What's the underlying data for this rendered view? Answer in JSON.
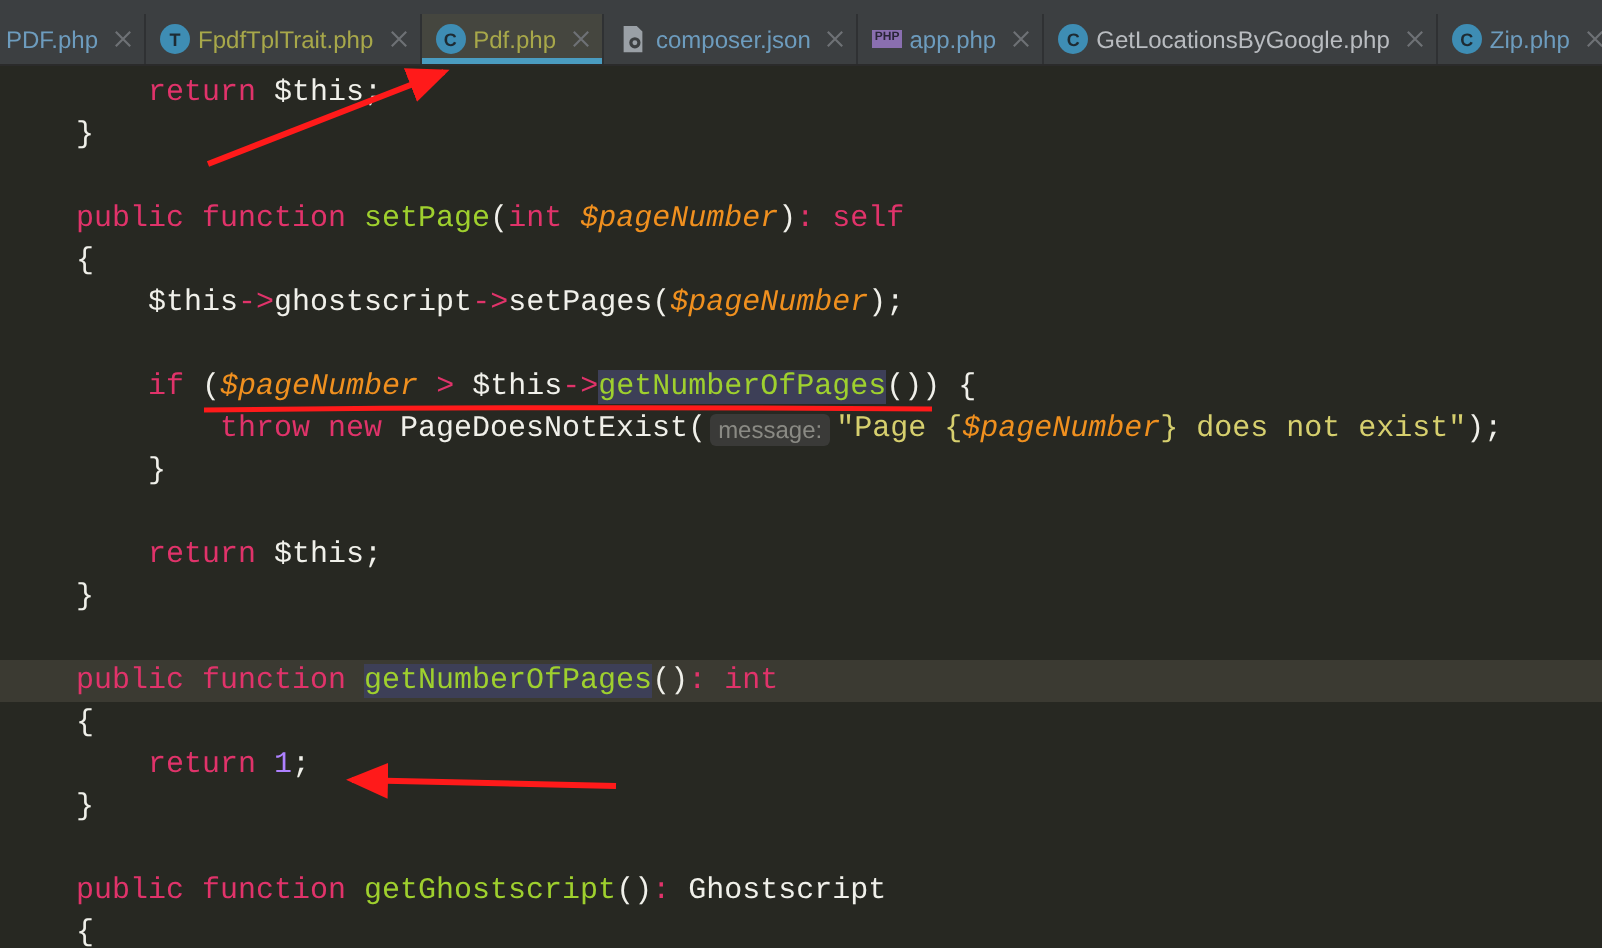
{
  "tabs": [
    {
      "label": "PDF.php",
      "kind": "plain",
      "color": "#6d9cbe",
      "selected": false
    },
    {
      "label": "FpdfTplTrait.php",
      "kind": "trait",
      "icon_letter": "T",
      "color": "#a8a84a",
      "selected": false
    },
    {
      "label": "Pdf.php",
      "kind": "class",
      "icon_letter": "C",
      "color": "#a8a84a",
      "selected": true
    },
    {
      "label": "composer.json",
      "kind": "json",
      "color": "#6d9cbe",
      "selected": false
    },
    {
      "label": "app.php",
      "kind": "php",
      "icon_letter": "PHP",
      "color": "#6d9cbe",
      "selected": false
    },
    {
      "label": "GetLocationsByGoogle.php",
      "kind": "class",
      "icon_letter": "C",
      "color": "#b9bcc0",
      "selected": false
    },
    {
      "label": "Zip.php",
      "kind": "class",
      "icon_letter": "C",
      "color": "#6d9cbe",
      "selected": false
    }
  ],
  "code": {
    "lines": [
      {
        "current": false,
        "tokens": [
          {
            "kind": "keyword",
            "text": "    return"
          },
          {
            "kind": "plain",
            "text": " $this;"
          }
        ]
      },
      {
        "current": false,
        "tokens": [
          {
            "kind": "plain",
            "text": "}"
          }
        ]
      },
      {
        "current": false
      },
      {
        "current": false,
        "tokens": [
          {
            "kind": "keyword",
            "text": "public function "
          },
          {
            "kind": "method",
            "text": "setPage"
          },
          {
            "kind": "plain",
            "text": "("
          },
          {
            "kind": "keyword",
            "text": "int "
          },
          {
            "kind": "param",
            "text": "$pageNumber"
          },
          {
            "kind": "plain",
            "text": ")"
          },
          {
            "kind": "keyword",
            "text": ": self"
          }
        ]
      },
      {
        "current": false,
        "tokens": [
          {
            "kind": "plain",
            "text": "{"
          }
        ]
      },
      {
        "current": false,
        "tokens": [
          {
            "kind": "plain",
            "text": "    $this"
          },
          {
            "kind": "keyword",
            "text": "->"
          },
          {
            "kind": "plain",
            "text": "ghostscript"
          },
          {
            "kind": "keyword",
            "text": "->"
          },
          {
            "kind": "plain",
            "text": "setPages("
          },
          {
            "kind": "param",
            "text": "$pageNumber"
          },
          {
            "kind": "plain",
            "text": ");"
          }
        ]
      },
      {
        "current": false
      },
      {
        "current": false,
        "tokens": [
          {
            "kind": "keyword",
            "text": "    if "
          },
          {
            "kind": "plain",
            "text": "("
          },
          {
            "kind": "param",
            "text": "$pageNumber"
          },
          {
            "kind": "keyword",
            "text": " > "
          },
          {
            "kind": "plain",
            "text": "$this"
          },
          {
            "kind": "keyword",
            "text": "->"
          },
          {
            "kind": "method",
            "text": "getNumberOfPages",
            "highlighted": true
          },
          {
            "kind": "plain",
            "text": "()) {"
          }
        ]
      },
      {
        "current": false,
        "tokens": [
          {
            "kind": "keyword",
            "text": "        throw new "
          },
          {
            "kind": "plain",
            "text": "PageDoesNotExist("
          },
          {
            "kind": "hint",
            "text": "message:"
          },
          {
            "kind": "string",
            "text": "\"Page {"
          },
          {
            "kind": "param",
            "text": "$pageNumber"
          },
          {
            "kind": "string",
            "text": "} does not exist\""
          },
          {
            "kind": "plain",
            "text": ");"
          }
        ]
      },
      {
        "current": false,
        "tokens": [
          {
            "kind": "plain",
            "text": "    }"
          }
        ]
      },
      {
        "current": false
      },
      {
        "current": false,
        "tokens": [
          {
            "kind": "keyword",
            "text": "    return "
          },
          {
            "kind": "plain",
            "text": "$this;"
          }
        ]
      },
      {
        "current": false,
        "tokens": [
          {
            "kind": "plain",
            "text": "}"
          }
        ]
      },
      {
        "current": false
      },
      {
        "current": true,
        "tokens": [
          {
            "kind": "keyword",
            "text": "public function "
          },
          {
            "kind": "method",
            "text": "getNumberOfPages",
            "highlighted": true
          },
          {
            "kind": "plain",
            "text": "()"
          },
          {
            "kind": "keyword",
            "text": ": int"
          }
        ]
      },
      {
        "current": false,
        "tokens": [
          {
            "kind": "plain",
            "text": "{"
          }
        ]
      },
      {
        "current": false,
        "tokens": [
          {
            "kind": "keyword",
            "text": "    return "
          },
          {
            "kind": "number",
            "text": "1"
          },
          {
            "kind": "plain",
            "text": ";"
          }
        ]
      },
      {
        "current": false,
        "tokens": [
          {
            "kind": "plain",
            "text": "}"
          }
        ]
      },
      {
        "current": false
      },
      {
        "current": false,
        "tokens": [
          {
            "kind": "keyword",
            "text": "public function "
          },
          {
            "kind": "method",
            "text": "getGhostscript"
          },
          {
            "kind": "plain",
            "text": "()"
          },
          {
            "kind": "keyword",
            "text": ": "
          },
          {
            "kind": "plain",
            "text": "Ghostscript"
          }
        ]
      },
      {
        "current": false,
        "tokens": [
          {
            "kind": "plain",
            "text": "{"
          }
        ]
      }
    ]
  }
}
